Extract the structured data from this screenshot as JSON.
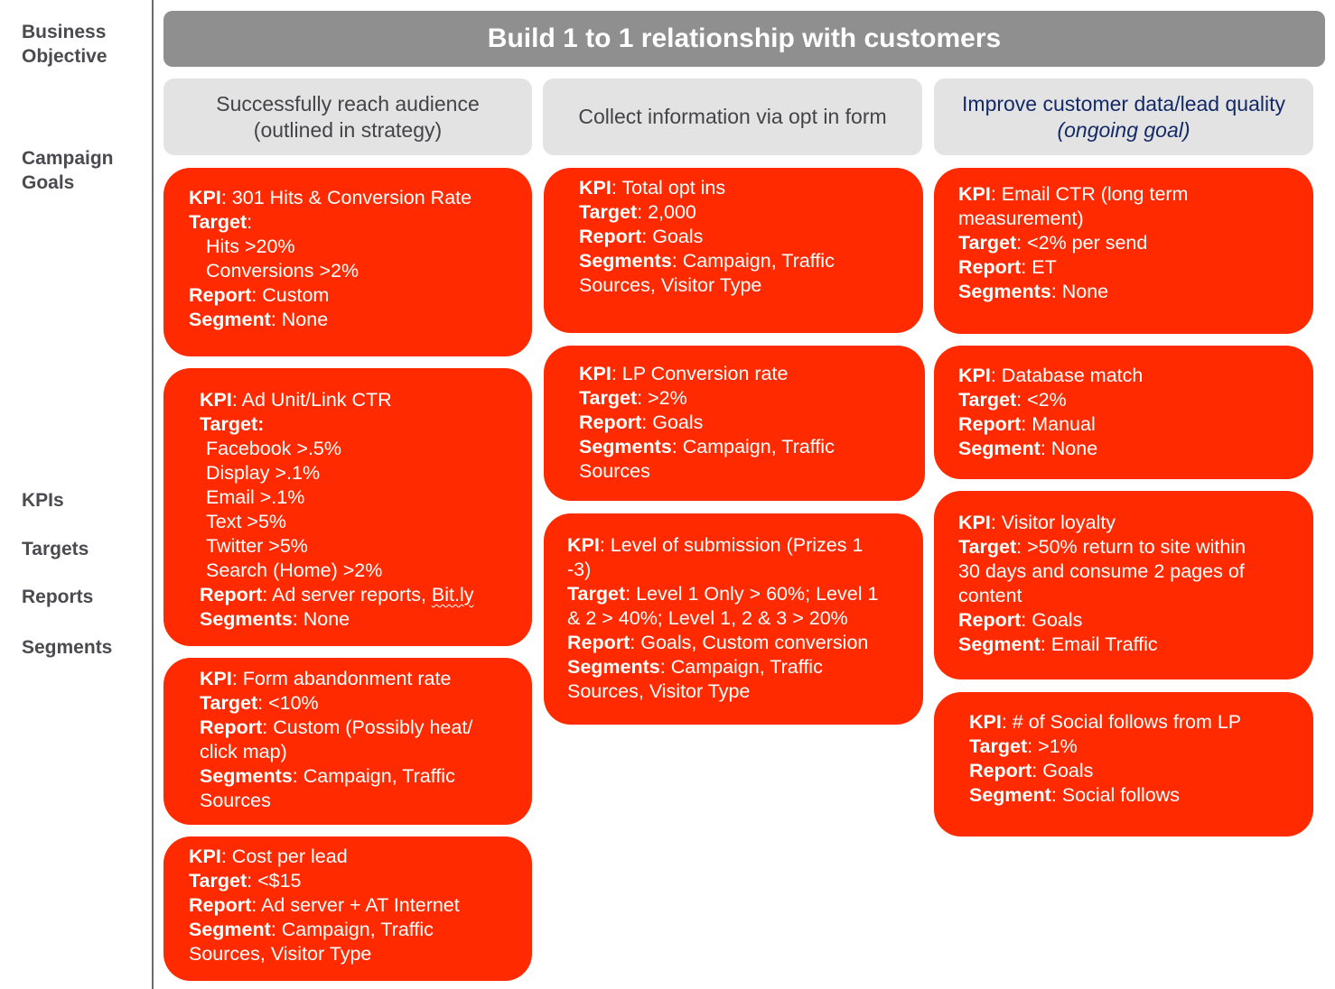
{
  "row_labels": {
    "business_objective": "Business\nObjective",
    "business_objective_l1": "Business",
    "business_objective_l2": "Objective",
    "campaign_goals_l1": "Campaign",
    "campaign_goals_l2": "Goals",
    "kpis": "KPIs",
    "targets": "Targets",
    "reports": "Reports",
    "segments": "Segments"
  },
  "objective": "Build 1 to 1 relationship with customers",
  "goals": [
    {
      "line1": "Successfully reach audience",
      "line2": "(outlined in strategy)"
    },
    {
      "line1": "Collect information via opt in form"
    },
    {
      "line1": "Improve customer data/lead quality",
      "line2": "(ongoing goal)"
    }
  ],
  "labels": {
    "kpi": "KPI",
    "target": "Target",
    "report": "Report",
    "segment": "Segment",
    "segments": "Segments"
  },
  "columns": [
    {
      "cards": [
        {
          "kpi": "301 Hits & Conversion Rate",
          "target_items": [
            "Hits >20%",
            "Conversions >2%"
          ],
          "report": "Custom",
          "segment": "None"
        },
        {
          "kpi": "Ad Unit/Link CTR",
          "target_items": [
            "Facebook >.5%",
            "Display >.1%",
            "Email >.1%",
            "Text >5%",
            "Twitter >5%",
            "Search (Home) >2%"
          ],
          "report_prefix": "Ad server reports, ",
          "report_link": "Bit.ly",
          "segments": "None"
        },
        {
          "kpi": "Form abandonment rate",
          "target": "<10%",
          "report_l1": "Custom (Possibly heat/",
          "report_l2": "click map)",
          "segments_l1": "Campaign, Traffic",
          "segments_l2": "Sources"
        },
        {
          "kpi": "Cost per lead",
          "target": "<$15",
          "report": "Ad server + AT Internet",
          "segment_l1": "Campaign, Traffic",
          "segment_l2": "Sources, Visitor Type"
        }
      ]
    },
    {
      "cards": [
        {
          "kpi": "Total opt ins",
          "target": "2,000",
          "report": "Goals",
          "segments_l1": "Campaign, Traffic",
          "segments_l2": "Sources, Visitor Type"
        },
        {
          "kpi": "LP Conversion rate",
          "target": ">2%",
          "report": "Goals",
          "segments_l1": "Campaign, Traffic",
          "segments_l2": "Sources"
        },
        {
          "kpi_l1": "Level of submission (Prizes 1",
          "kpi_l2": "-3)",
          "target_l1": "Level 1 Only > 60%; Level 1",
          "target_l2": "& 2 > 40%; Level 1, 2 & 3 > 20%",
          "report": "Goals, Custom conversion",
          "segments_l1": "Campaign, Traffic",
          "segments_l2": "Sources, Visitor Type"
        }
      ]
    },
    {
      "cards": [
        {
          "kpi_l1": "Email CTR (long term",
          "kpi_l2": "measurement)",
          "target": "<2% per send",
          "report": "ET",
          "segments": "None"
        },
        {
          "kpi": "Database match",
          "target": "<2%",
          "report": "Manual",
          "segment": "None"
        },
        {
          "kpi": "Visitor loyalty",
          "target_l1": ">50% return to site within",
          "target_l2": "30 days and consume 2 pages of",
          "target_l3": "content",
          "report": "Goals",
          "segment": "Email Traffic"
        },
        {
          "kpi": "# of Social follows from LP",
          "target": ">1%",
          "report": "Goals",
          "segment": "Social follows"
        }
      ]
    }
  ],
  "colors": {
    "objective_bg": "#8f8f8f",
    "goal_bg": "#e3e3e3",
    "kpi_card_bg": "#ff2a00",
    "label_text": "#4a4a50",
    "goal_blue_text": "#142a66"
  }
}
